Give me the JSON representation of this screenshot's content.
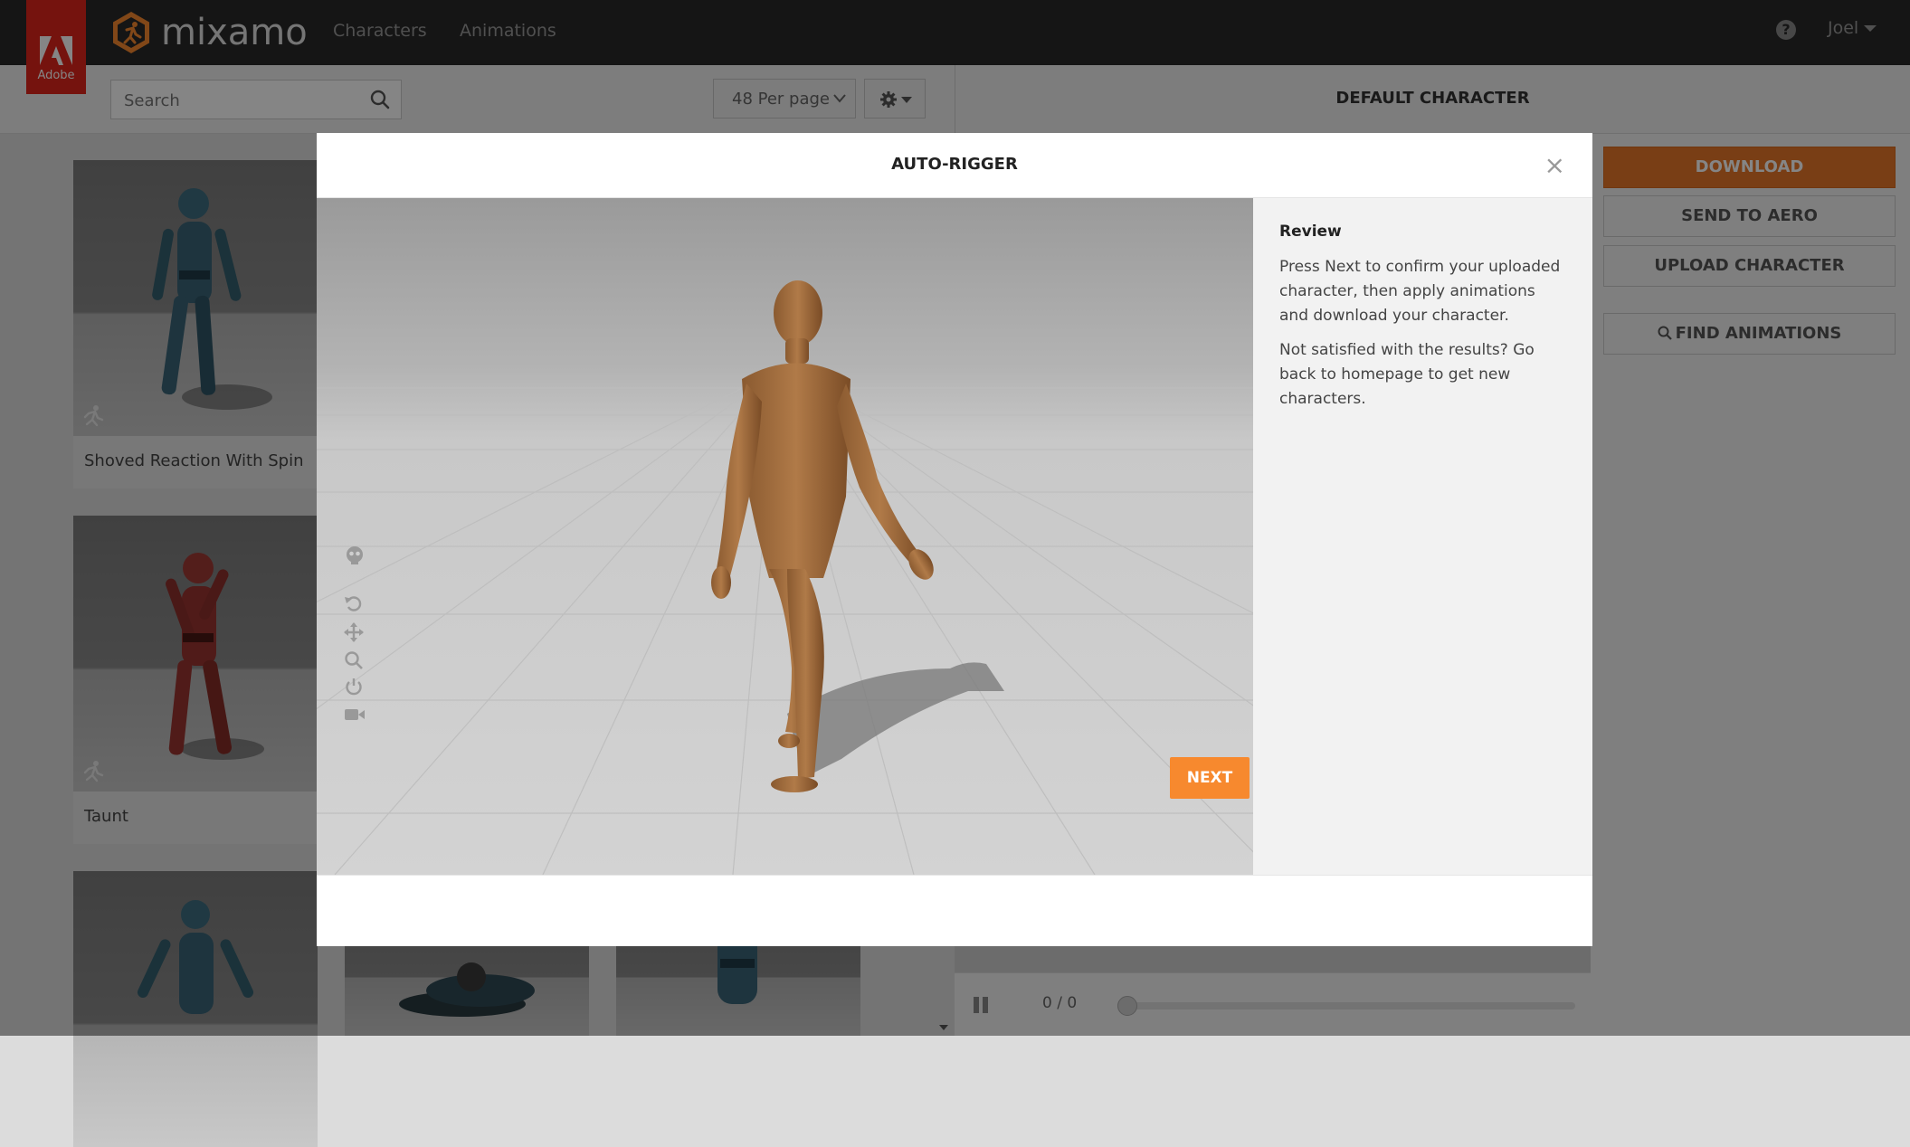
{
  "brand": {
    "adobe_label": "Adobe",
    "logo_text": "mixamo"
  },
  "nav": {
    "links": [
      "Characters",
      "Animations"
    ],
    "user": "Joel",
    "help_glyph": "?"
  },
  "toolbar": {
    "search_placeholder": "Search",
    "per_page": "48 Per page"
  },
  "right_panel": {
    "title": "DEFAULT CHARACTER",
    "buttons": [
      "DOWNLOAD",
      "SEND TO AERO",
      "UPLOAD CHARACTER",
      "FIND ANIMATIONS"
    ],
    "time": "0 / 0"
  },
  "grid": {
    "cards": [
      {
        "label": "Shoved Reaction With Spin"
      },
      {
        "label": "Taunt"
      }
    ]
  },
  "modal": {
    "title": "AUTO-RIGGER",
    "close_glyph": "×",
    "review_heading": "Review",
    "review_text_1": "Press Next to confirm your uploaded character, then apply animations and download your character.",
    "review_text_2": "Not satisfied with the results? Go back to homepage to get new characters.",
    "next_label": "NEXT"
  },
  "icons": {
    "search": "search-icon",
    "settings": "gear-icon",
    "close": "close-icon",
    "viewer_tools": [
      "skeleton-icon",
      "reset-rotate-icon",
      "pan-icon",
      "zoom-icon",
      "power-icon",
      "camera-icon"
    ]
  },
  "colors": {
    "accent": "#f7892e",
    "download": "#e8782a",
    "topbar": "#2a2a2a",
    "adobe_red": "#e1251b"
  }
}
